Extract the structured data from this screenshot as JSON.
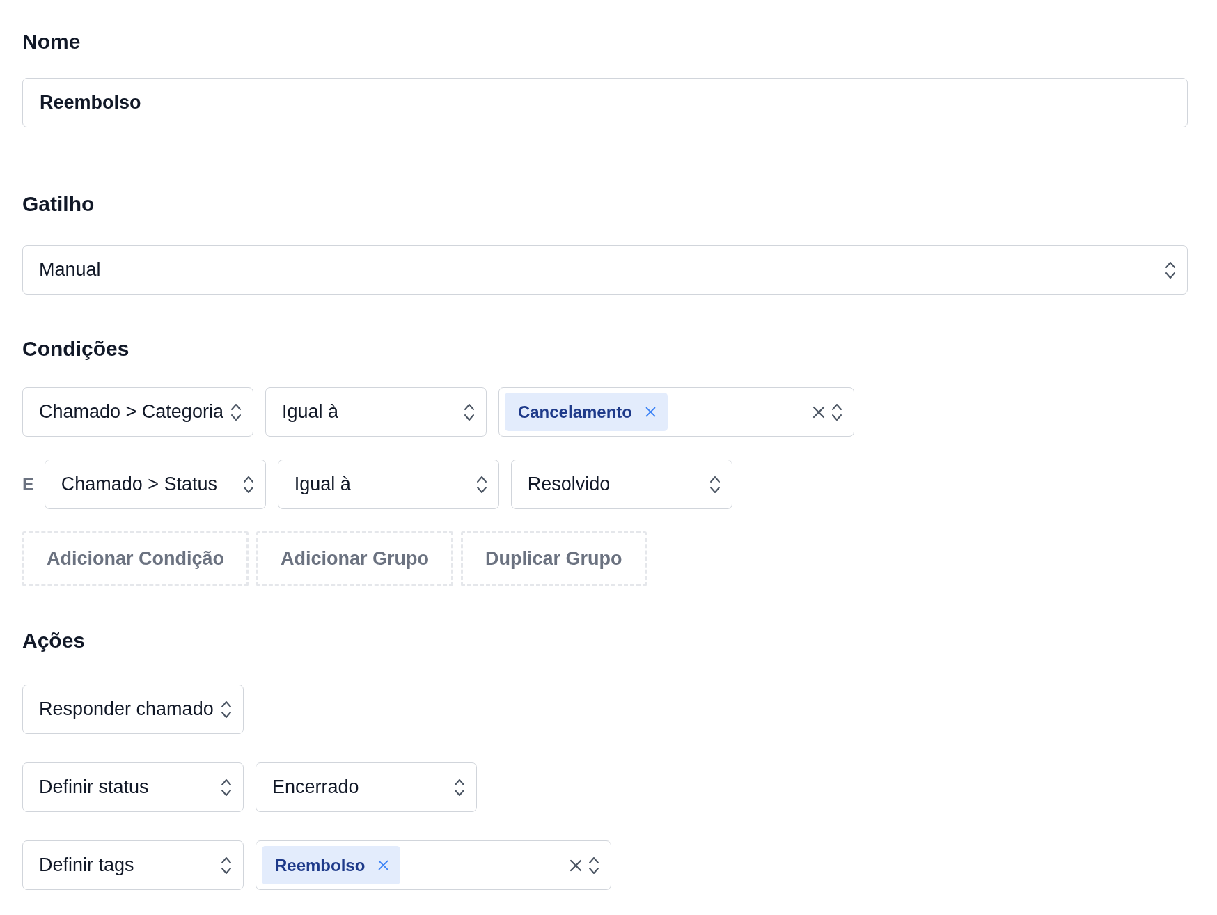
{
  "name": {
    "label": "Nome",
    "value": "Reembolso"
  },
  "trigger": {
    "label": "Gatilho",
    "value": "Manual"
  },
  "conditions": {
    "label": "Condições",
    "rows": [
      {
        "fields": [
          {
            "kind": "select",
            "value": "Chamado > Categoria"
          },
          {
            "kind": "select",
            "value": "Igual à"
          },
          {
            "kind": "multi",
            "tags": [
              "Cancelamento"
            ]
          }
        ]
      },
      {
        "connector": "E",
        "fields": [
          {
            "kind": "select",
            "value": "Chamado > Status"
          },
          {
            "kind": "select",
            "value": "Igual à"
          },
          {
            "kind": "select",
            "value": "Resolvido"
          }
        ]
      }
    ],
    "buttons": [
      "Adicionar Condição",
      "Adicionar Grupo",
      "Duplicar Grupo"
    ]
  },
  "actions": {
    "label": "Ações",
    "rows": [
      {
        "fields": [
          {
            "kind": "select",
            "value": "Responder chamado"
          }
        ]
      },
      {
        "fields": [
          {
            "kind": "select",
            "value": "Definir status"
          },
          {
            "kind": "select",
            "value": "Encerrado"
          }
        ]
      },
      {
        "fields": [
          {
            "kind": "select",
            "value": "Definir tags"
          },
          {
            "kind": "multi",
            "tags": [
              "Reembolso"
            ]
          }
        ]
      }
    ]
  }
}
